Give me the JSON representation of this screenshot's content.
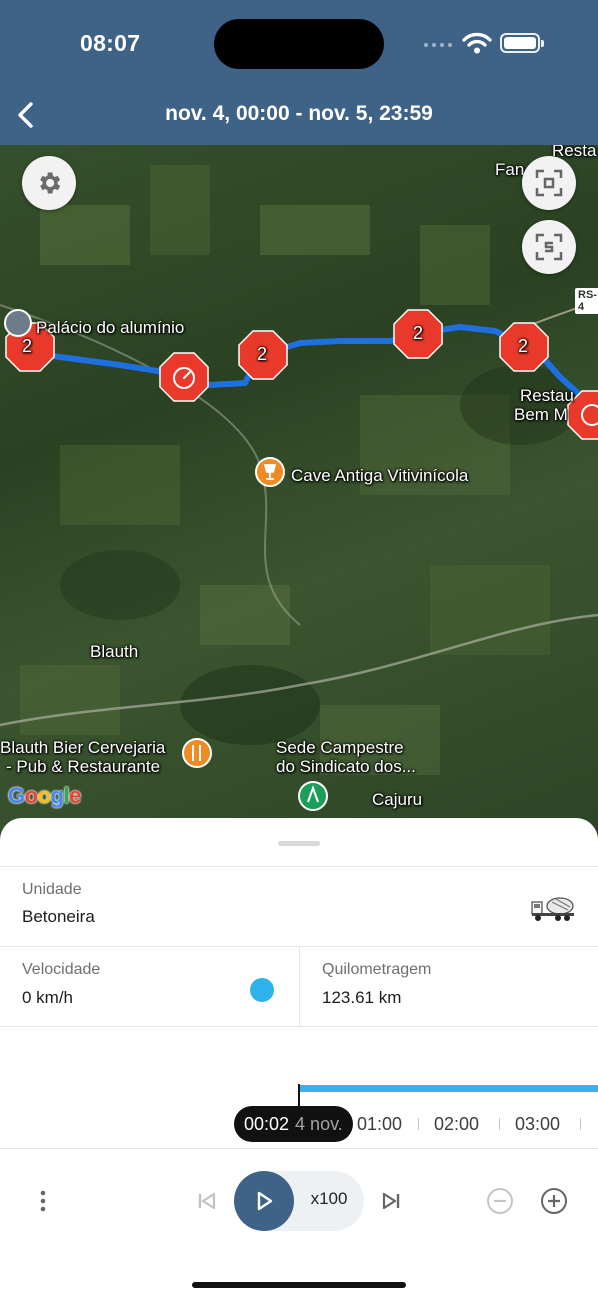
{
  "status_bar": {
    "time": "08:07"
  },
  "header": {
    "title": "nov. 4, 00:00 - nov. 5, 23:59",
    "back_icon": "chevron-left-icon"
  },
  "map": {
    "labels": {
      "palacio": "Palácio do alumínio",
      "cave": "Cave Antiga Vitivinícola",
      "blauth": "Blauth",
      "blauth_bier_1": "Blauth Bier Cervejaria",
      "blauth_bier_2": "- Pub & Restaurante",
      "sede_1": "Sede Campestre",
      "sede_2": "do Sindicato dos...",
      "cajuru": "Cajuru",
      "resta_top_1": "Resta",
      "resta_top_2": "Fan trap",
      "resta_right_1": "Restau",
      "resta_right_2": "Bem M",
      "road_rs": "RS-4",
      "google": "Google"
    },
    "markers": {
      "cluster_count": "2"
    },
    "buttons": {
      "settings": "gear-icon",
      "fit": "focus-frame-icon",
      "snapshot": "scan-icon"
    }
  },
  "sheet": {
    "unit_label": "Unidade",
    "unit_value": "Betoneira",
    "speed_label": "Velocidade",
    "speed_value": "0 km/h",
    "odometer_label": "Quilometragem",
    "odometer_value": "123.61 km",
    "status_color": "#2eb2ec"
  },
  "timeline": {
    "current_time": "00:02",
    "current_date": "4 nov.",
    "ticks": [
      "01:00",
      "02:00",
      "03:00"
    ]
  },
  "controls": {
    "speed": "x100"
  }
}
